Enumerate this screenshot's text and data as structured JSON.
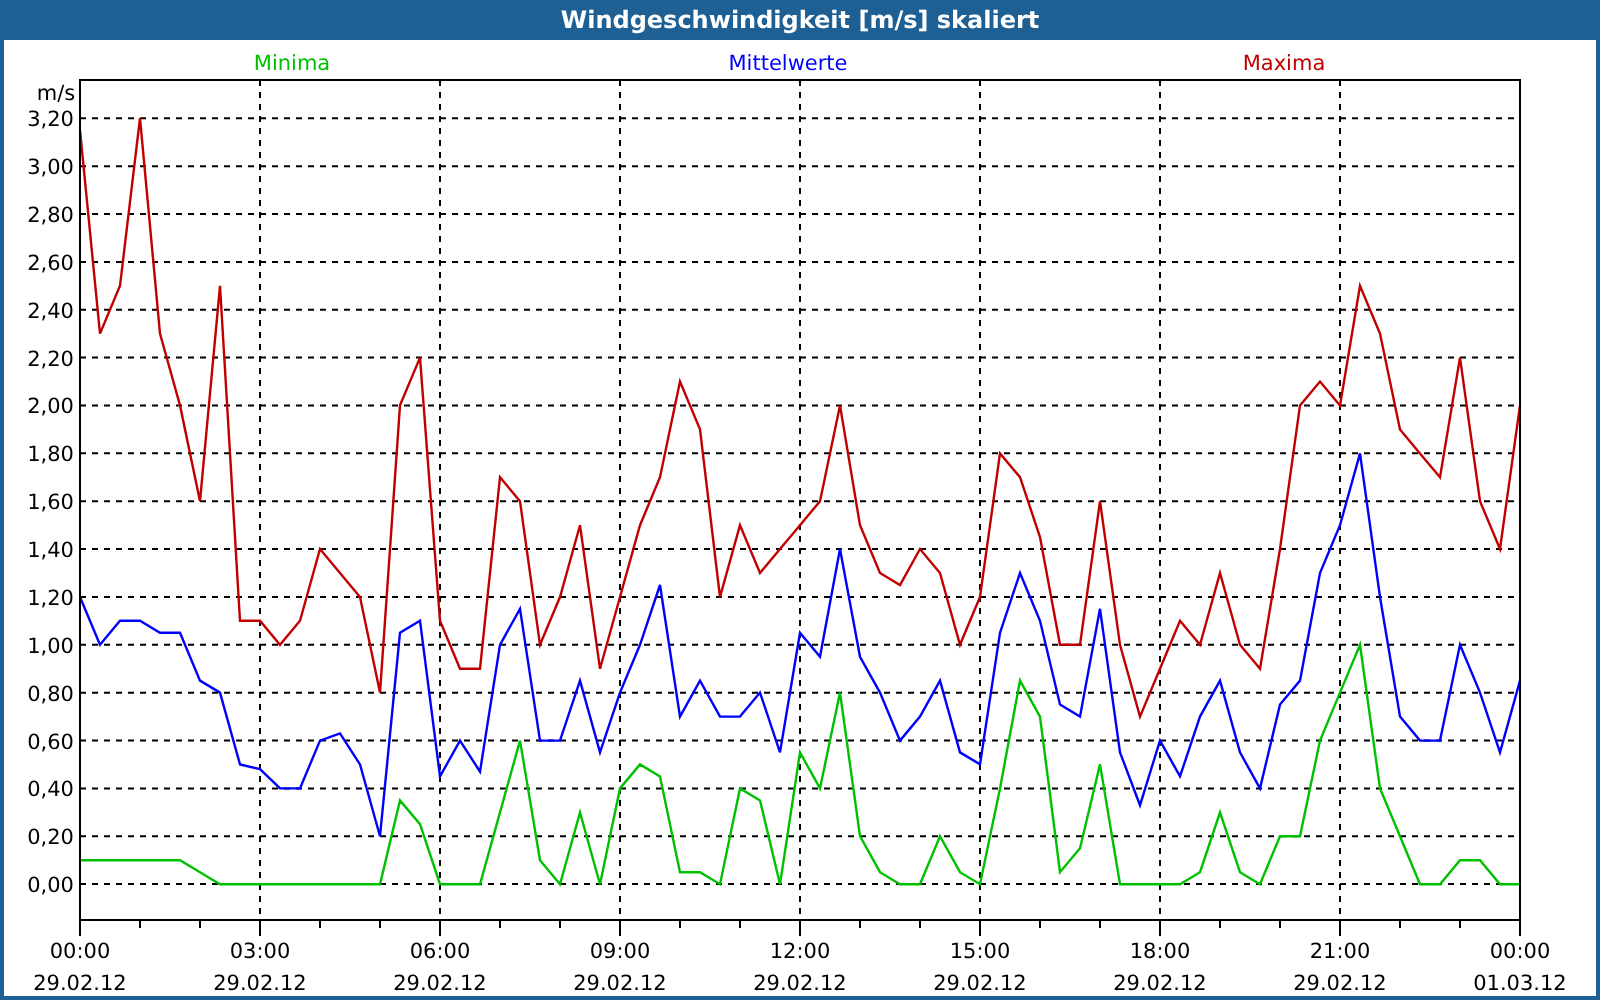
{
  "window": {
    "title": "Windgeschwindigkeit [m/s] skaliert"
  },
  "chart": {
    "chart_data": {
      "type": "line",
      "ylabel": "m/s",
      "categories": [
        "00:00 29.02.12",
        null,
        null,
        null,
        null,
        null,
        null,
        null,
        null,
        "03:00 29.02.12",
        null,
        null,
        null,
        null,
        null,
        null,
        null,
        null,
        "06:00 29.02.12",
        null,
        null,
        null,
        null,
        null,
        null,
        null,
        null,
        "09:00 29.02.12",
        null,
        null,
        null,
        null,
        null,
        null,
        null,
        null,
        "12:00 29.02.12",
        null,
        null,
        null,
        null,
        null,
        null,
        null,
        null,
        "15:00 29.02.12",
        null,
        null,
        null,
        null,
        null,
        null,
        null,
        null,
        "18:00 29.02.12",
        null,
        null,
        null,
        null,
        null,
        null,
        null,
        null,
        "21:00 29.02.12",
        null,
        null,
        null,
        null,
        null,
        null,
        null,
        null,
        "00:00 01.03.12"
      ],
      "ylim": [
        -0.15,
        3.36
      ],
      "grid": true,
      "yticks": [
        {
          "value": 0,
          "label": "0,00"
        },
        {
          "value": 0.2,
          "label": "0,20"
        },
        {
          "value": 0.4,
          "label": "0,40"
        },
        {
          "value": 0.6,
          "label": "0,60"
        },
        {
          "value": 0.8,
          "label": "0,80"
        },
        {
          "value": 1,
          "label": "1,00"
        },
        {
          "value": 1.2,
          "label": "1,20"
        },
        {
          "value": 1.4,
          "label": "1,40"
        },
        {
          "value": 1.6,
          "label": "1,60"
        },
        {
          "value": 1.8,
          "label": "1,80"
        },
        {
          "value": 2,
          "label": "2,00"
        },
        {
          "value": 2.2,
          "label": "2,20"
        },
        {
          "value": 2.4,
          "label": "2,40"
        },
        {
          "value": 2.6,
          "label": "2,60"
        },
        {
          "value": 2.8,
          "label": "2,80"
        },
        {
          "value": 3,
          "label": "3,00"
        },
        {
          "value": 3.2,
          "label": "3,20"
        }
      ],
      "series": [
        {
          "name": "Minima",
          "color": "#00c000",
          "values": [
            0.1,
            0.1,
            0.1,
            0.1,
            0.1,
            0.1,
            0.05,
            0,
            0,
            0,
            0,
            0,
            0,
            0,
            0,
            0,
            0.35,
            0.25,
            0,
            0,
            0,
            0.3,
            0.6,
            0.1,
            0,
            0.3,
            0,
            0.4,
            0.5,
            0.45,
            0.05,
            0.05,
            0,
            0.4,
            0.35,
            0,
            0.55,
            0.4,
            0.8,
            0.2,
            0.05,
            0,
            0,
            0.2,
            0.05,
            0,
            0.4,
            0.85,
            0.7,
            0.05,
            0.15,
            0.5,
            0,
            0,
            0,
            0,
            0.05,
            0.3,
            0.05,
            0,
            0.2,
            0.2,
            0.6,
            0.8,
            1,
            0.4,
            0.2,
            0,
            0,
            0.1,
            0.1,
            0,
            0
          ]
        },
        {
          "name": "Mittelwerte",
          "color": "#0000ff",
          "values": [
            1.2,
            1,
            1.1,
            1.1,
            1.05,
            1.05,
            0.85,
            0.8,
            0.5,
            0.48,
            0.4,
            0.4,
            0.6,
            0.63,
            0.5,
            0.2,
            1.05,
            1.1,
            0.45,
            0.6,
            0.47,
            1,
            1.15,
            0.6,
            0.6,
            0.85,
            0.55,
            0.8,
            1,
            1.25,
            0.7,
            0.85,
            0.7,
            0.7,
            0.8,
            0.55,
            1.05,
            0.95,
            1.4,
            0.95,
            0.8,
            0.6,
            0.7,
            0.85,
            0.55,
            0.5,
            1.05,
            1.3,
            1.1,
            0.75,
            0.7,
            1.15,
            0.55,
            0.33,
            0.6,
            0.45,
            0.7,
            0.85,
            0.55,
            0.4,
            0.75,
            0.85,
            1.3,
            1.5,
            1.8,
            1.2,
            0.7,
            0.6,
            0.6,
            1,
            0.8,
            0.55,
            0.85
          ]
        },
        {
          "name": "Maxima",
          "color": "#c00000",
          "values": [
            3.15,
            2.3,
            2.5,
            3.2,
            2.3,
            2,
            1.6,
            2.5,
            1.1,
            1.1,
            1,
            1.1,
            1.4,
            1.3,
            1.2,
            0.8,
            2,
            2.2,
            1.1,
            0.9,
            0.9,
            1.7,
            1.6,
            1,
            1.2,
            1.5,
            0.9,
            1.2,
            1.5,
            1.7,
            2.1,
            1.9,
            1.2,
            1.5,
            1.3,
            1.4,
            1.5,
            1.6,
            2,
            1.5,
            1.3,
            1.25,
            1.4,
            1.3,
            1,
            1.2,
            1.8,
            1.7,
            1.45,
            1,
            1,
            1.6,
            1,
            0.7,
            0.9,
            1.1,
            1,
            1.3,
            1,
            0.9,
            1.4,
            2,
            2.1,
            2,
            2.5,
            2.3,
            1.9,
            1.8,
            1.7,
            2.2,
            1.6,
            1.4,
            2
          ]
        }
      ]
    }
  }
}
